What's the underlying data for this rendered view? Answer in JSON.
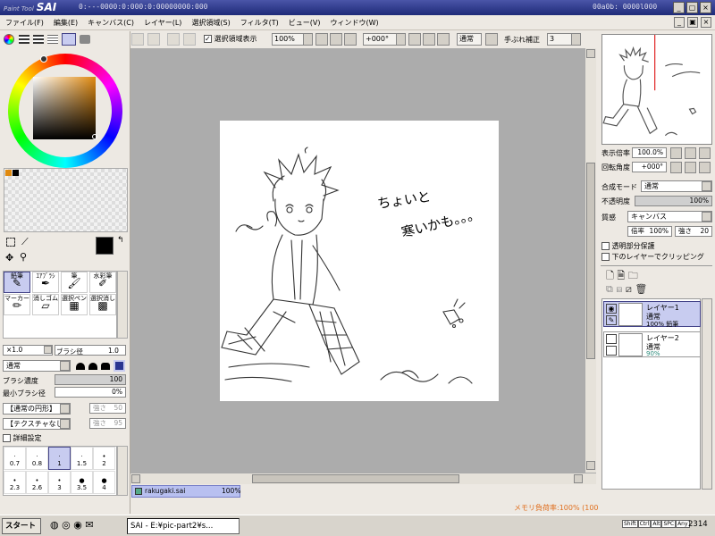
{
  "titlebar": {
    "logo_small": "Paint Tool",
    "logo": "SAI",
    "info": "0:---0000:0:000:0:00000000:000",
    "info2": "00a0b: 0000l000"
  },
  "menu": [
    "ファイル(F)",
    "編集(E)",
    "キャンバス(C)",
    "レイヤー(L)",
    "選択領域(S)",
    "フィルタ(T)",
    "ビュー(V)",
    "ウィンドウ(W)"
  ],
  "toolbar": {
    "show_selection": "選択領域表示",
    "zoom": "100%",
    "rotation": "+000°",
    "blend": "通常",
    "stabilizer_label": "手ぶれ補正",
    "stabilizer": "3"
  },
  "left": {
    "tools": [
      "鉛筆",
      "ｴｱﾌﾞﾗｼ",
      "筆",
      "水彩筆",
      "マーカー",
      "消しゴム",
      "選択ペン",
      "選択消し"
    ],
    "size_mult": "×1.0",
    "brush_size_label": "ブラシ径",
    "brush_size": "1.0",
    "mode": "通常",
    "density_label": "ブラシ濃度",
    "density": "100",
    "min_size_label": "最小ブラシ径",
    "min_size": "0%",
    "shape": "【通常の円形】",
    "shape_val_label": "強さ",
    "shape_val": "50",
    "texture": "【テクスチャなし】",
    "texture_val_label": "強さ",
    "texture_val": "95",
    "detail": "詳細設定",
    "sizes": [
      "0.7",
      "0.8",
      "1",
      "1.5",
      "2",
      "2.3",
      "2.6",
      "3",
      "3.5",
      "4"
    ]
  },
  "canvas": {
    "text1": "ちょいと",
    "text2": "寒いかも。。。"
  },
  "doc_tab": {
    "name": "rakugaki.sai",
    "zoom": "100%"
  },
  "right": {
    "zoom_label": "表示倍率",
    "zoom": "100.0%",
    "angle_label": "回転角度",
    "angle": "+000°",
    "blend_label": "合成モード",
    "blend": "通常",
    "opacity_label": "不透明度",
    "opacity": "100%",
    "texture_label": "質感",
    "texture": "キャンバス",
    "scale_label": "倍率",
    "scale": "100%",
    "strength_label": "強さ",
    "strength": "20",
    "preserve": "透明部分保護",
    "clipping": "下のレイヤーでクリッピング",
    "layers": [
      {
        "name": "レイヤー1",
        "mode": "通常",
        "opacity": "100% 鉛筆"
      },
      {
        "name": "レイヤー2",
        "mode": "通常",
        "opacity": "90%"
      }
    ]
  },
  "status": {
    "memory": "メモリ負荷率:100% (100MB確保)"
  },
  "taskbar": {
    "start": "スタート",
    "task": "SAI - E:¥pic-part2¥s...",
    "keys": [
      "Shift",
      "Ctrl",
      "Alt",
      "SPC",
      "Any"
    ],
    "clock": "2314"
  },
  "colors": {
    "title": "#2a3590",
    "accent": "#e07020"
  }
}
